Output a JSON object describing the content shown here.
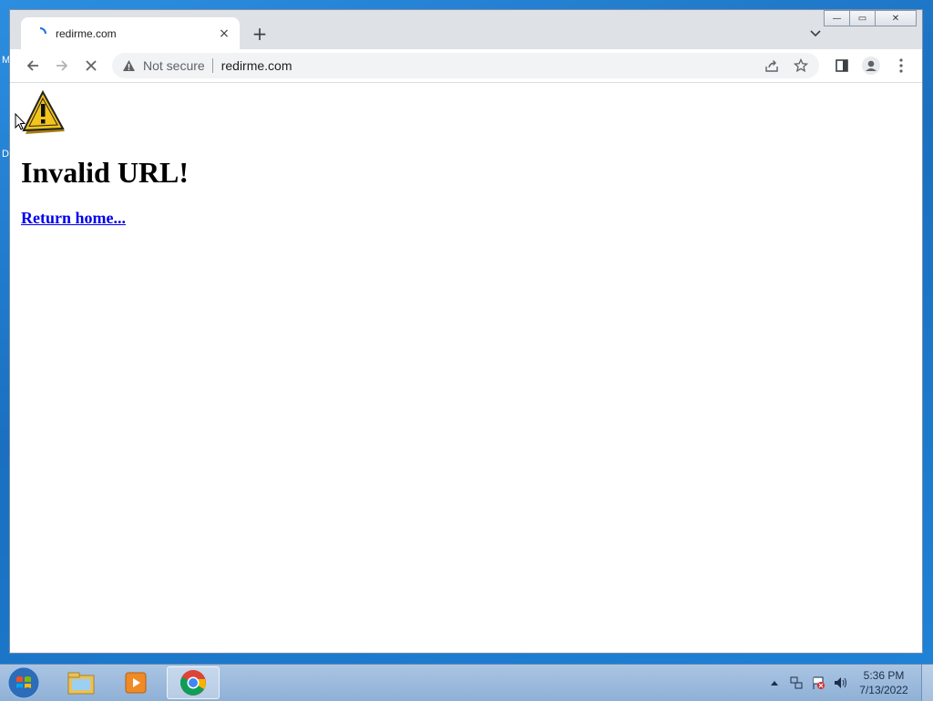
{
  "desktop": {
    "glyph_top": "M",
    "glyph_mid": "D"
  },
  "window": {
    "controls": {
      "minimize": "—",
      "maximize": "▭",
      "close": "✕"
    }
  },
  "tab": {
    "title": "redirme.com",
    "close": "×"
  },
  "newtab": {
    "label": "+"
  },
  "omnibox": {
    "security_label": "Not secure",
    "url": "redirme.com"
  },
  "page": {
    "heading": "Invalid URL!",
    "link_text": "Return home..."
  },
  "taskbar": {
    "clock": {
      "time": "5:36 PM",
      "date": "7/13/2022"
    }
  },
  "colors": {
    "link": "#0000ee",
    "desktop": "#1a6fc0",
    "warning_yellow": "#f3c41b"
  }
}
